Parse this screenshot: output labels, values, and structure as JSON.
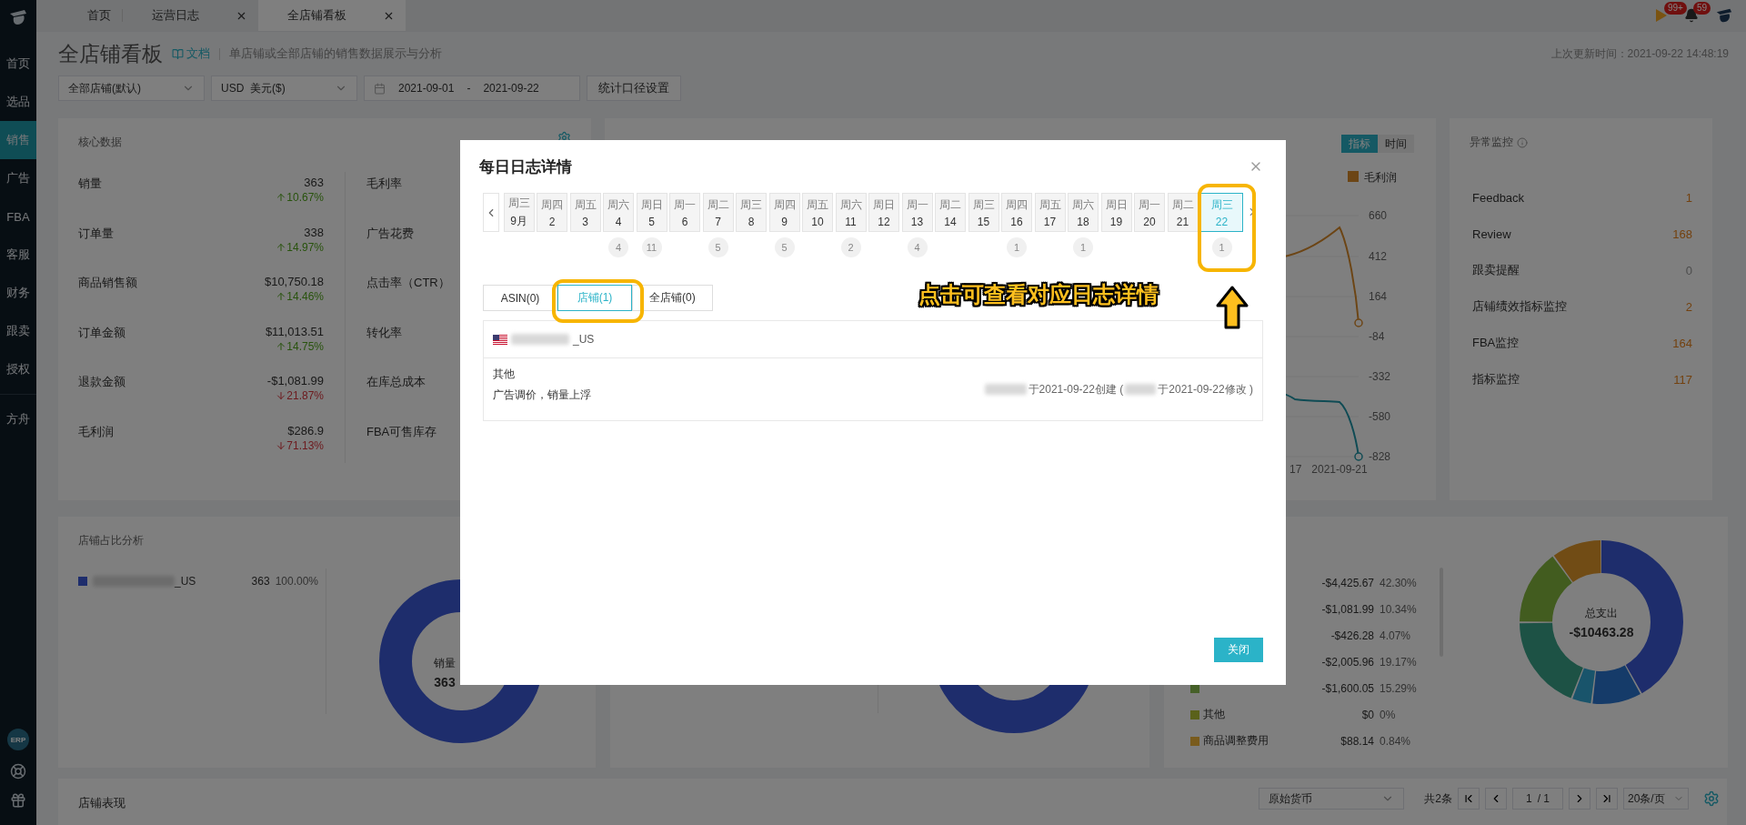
{
  "sidebar": {
    "items": [
      {
        "label": "首页",
        "selected": false
      },
      {
        "label": "选品",
        "selected": false
      },
      {
        "label": "销售",
        "selected": true
      },
      {
        "label": "广告",
        "selected": false
      },
      {
        "label": "FBA",
        "selected": false
      },
      {
        "label": "客服",
        "selected": false
      },
      {
        "label": "财务",
        "selected": false
      },
      {
        "label": "跟卖",
        "selected": false
      },
      {
        "label": "授权",
        "selected": false
      }
    ],
    "extra_items": [
      {
        "label": "方舟"
      }
    ],
    "erp_badge": "ERP"
  },
  "top_tabs": [
    {
      "label": "首页",
      "closable": false,
      "selected": false
    },
    {
      "label": "运营日志",
      "closable": true,
      "selected": false
    },
    {
      "label": "全店铺看板",
      "closable": true,
      "selected": true
    }
  ],
  "notifications": {
    "flag_count": "99+",
    "bell_count": "59"
  },
  "header": {
    "title": "全店铺看板",
    "doc_link": "文档",
    "description": "单店铺或全部店铺的销售数据展示与分析",
    "updated": "上次更新时间：2021-09-22 14:48:19"
  },
  "filters": {
    "store": "全部店铺(默认)",
    "currency": "USD  美元($)",
    "date_start": "2021-09-01",
    "date_sep": "-",
    "date_end": "2021-09-22",
    "settings_button": "统计口径设置"
  },
  "core_data": {
    "title": "核心数据",
    "metrics": [
      {
        "label": "销量",
        "value": "363",
        "change": "10.67%",
        "rising": true
      },
      {
        "label": "订单量",
        "value": "338",
        "change": "14.97%",
        "rising": true
      },
      {
        "label": "商品销售额",
        "value": "$10,750.18",
        "change": "14.46%",
        "rising": true
      },
      {
        "label": "订单金额",
        "value": "$11,013.51",
        "change": "14.75%",
        "rising": true
      },
      {
        "label": "退款金额",
        "value": "-$1,081.99",
        "change": "21.87%",
        "rising": false
      },
      {
        "label": "毛利润",
        "value": "$286.9",
        "change": "71.13%",
        "rising": false
      }
    ],
    "secondary_labels": [
      "毛利率",
      "广告花费",
      "点击率（CTR）",
      "转化率",
      "在库总成本",
      "FBA可售库存"
    ]
  },
  "trend_chart": {
    "toggle": [
      {
        "label": "指标",
        "selected": true
      },
      {
        "label": "时间",
        "selected": false
      }
    ],
    "legend": "毛利润",
    "y_ticks": [
      "660",
      "412",
      "164",
      "-84",
      "-332",
      "-580",
      "-828"
    ],
    "x_labels": [
      "17",
      "2021-09-21"
    ]
  },
  "anomaly": {
    "title": "异常监控",
    "items": [
      {
        "label": "Feedback",
        "count": "1",
        "alert": true
      },
      {
        "label": "Review",
        "count": "168",
        "alert": true
      },
      {
        "label": "跟卖提醒",
        "count": "0",
        "alert": false
      },
      {
        "label": "店铺绩效指标监控",
        "count": "2",
        "alert": true
      },
      {
        "label": "FBA监控",
        "count": "164",
        "alert": true
      },
      {
        "label": "指标监控",
        "count": "117",
        "alert": true
      }
    ]
  },
  "store_share": {
    "title": "店铺占比分析",
    "stores": [
      {
        "name": "_US",
        "value": "363",
        "percent": "100.00%",
        "color": "#1e2d6c"
      }
    ],
    "center_label": "销量",
    "center_value": "363"
  },
  "expense": {
    "rows": [
      {
        "value": "-$4,425.67",
        "percent": "42.30%"
      },
      {
        "value": "-$1,081.99",
        "percent": "10.34%"
      },
      {
        "value": "-$426.28",
        "percent": "4.07%"
      },
      {
        "value": "-$2,005.96",
        "percent": "19.17%"
      },
      {
        "value": "-$1,600.05",
        "percent": "15.29%",
        "color": "#466029"
      },
      {
        "label": "其他",
        "value": "$0",
        "percent": "0%",
        "color": "#5a611a"
      },
      {
        "label": "商品调整费用",
        "value": "$88.14",
        "percent": "0.84%",
        "color": "#795b1d"
      }
    ],
    "center_label": "总支出",
    "center_value": "-$10463.28"
  },
  "store_performance": {
    "title": "店铺表现",
    "currency_select": "原始货币",
    "total": "共2条",
    "page": "1",
    "pages": "/ 1",
    "page_size": "20条/页"
  },
  "log_modal": {
    "title": "每日日志详情",
    "days": [
      {
        "weekday": "周三",
        "day": "9月",
        "selected": false
      },
      {
        "weekday": "周四",
        "day": "2",
        "selected": false
      },
      {
        "weekday": "周五",
        "day": "3",
        "selected": false
      },
      {
        "weekday": "周六",
        "day": "4",
        "count": "4",
        "selected": false
      },
      {
        "weekday": "周日",
        "day": "5",
        "count": "11",
        "selected": false
      },
      {
        "weekday": "周一",
        "day": "6",
        "selected": false
      },
      {
        "weekday": "周二",
        "day": "7",
        "count": "5",
        "selected": false
      },
      {
        "weekday": "周三",
        "day": "8",
        "selected": false
      },
      {
        "weekday": "周四",
        "day": "9",
        "count": "5",
        "selected": false
      },
      {
        "weekday": "周五",
        "day": "10",
        "selected": false
      },
      {
        "weekday": "周六",
        "day": "11",
        "count": "2",
        "selected": false
      },
      {
        "weekday": "周日",
        "day": "12",
        "selected": false
      },
      {
        "weekday": "周一",
        "day": "13",
        "count": "4",
        "selected": false
      },
      {
        "weekday": "周二",
        "day": "14",
        "selected": false
      },
      {
        "weekday": "周三",
        "day": "15",
        "selected": false
      },
      {
        "weekday": "周四",
        "day": "16",
        "count": "1",
        "selected": false
      },
      {
        "weekday": "周五",
        "day": "17",
        "selected": false
      },
      {
        "weekday": "周六",
        "day": "18",
        "count": "1",
        "selected": false
      },
      {
        "weekday": "周日",
        "day": "19",
        "selected": false
      },
      {
        "weekday": "周一",
        "day": "20",
        "selected": false
      },
      {
        "weekday": "周二",
        "day": "21",
        "selected": false
      },
      {
        "weekday": "周三",
        "day": "22",
        "count": "1",
        "selected": true
      }
    ],
    "tabs": [
      {
        "label": "ASIN(0)",
        "selected": false
      },
      {
        "label": "店铺(1)",
        "selected": true
      },
      {
        "label": "全店铺(0)",
        "selected": false
      }
    ],
    "store": {
      "suffix": "_US"
    },
    "entry": {
      "category": "其他",
      "note": "广告调价，销量上浮",
      "created": "于2021-09-22创建 (",
      "modified": "于2021-09-22修改 )"
    },
    "close_button": "关闭",
    "annotation": {
      "text": "点击可查看对应日志详情"
    }
  }
}
